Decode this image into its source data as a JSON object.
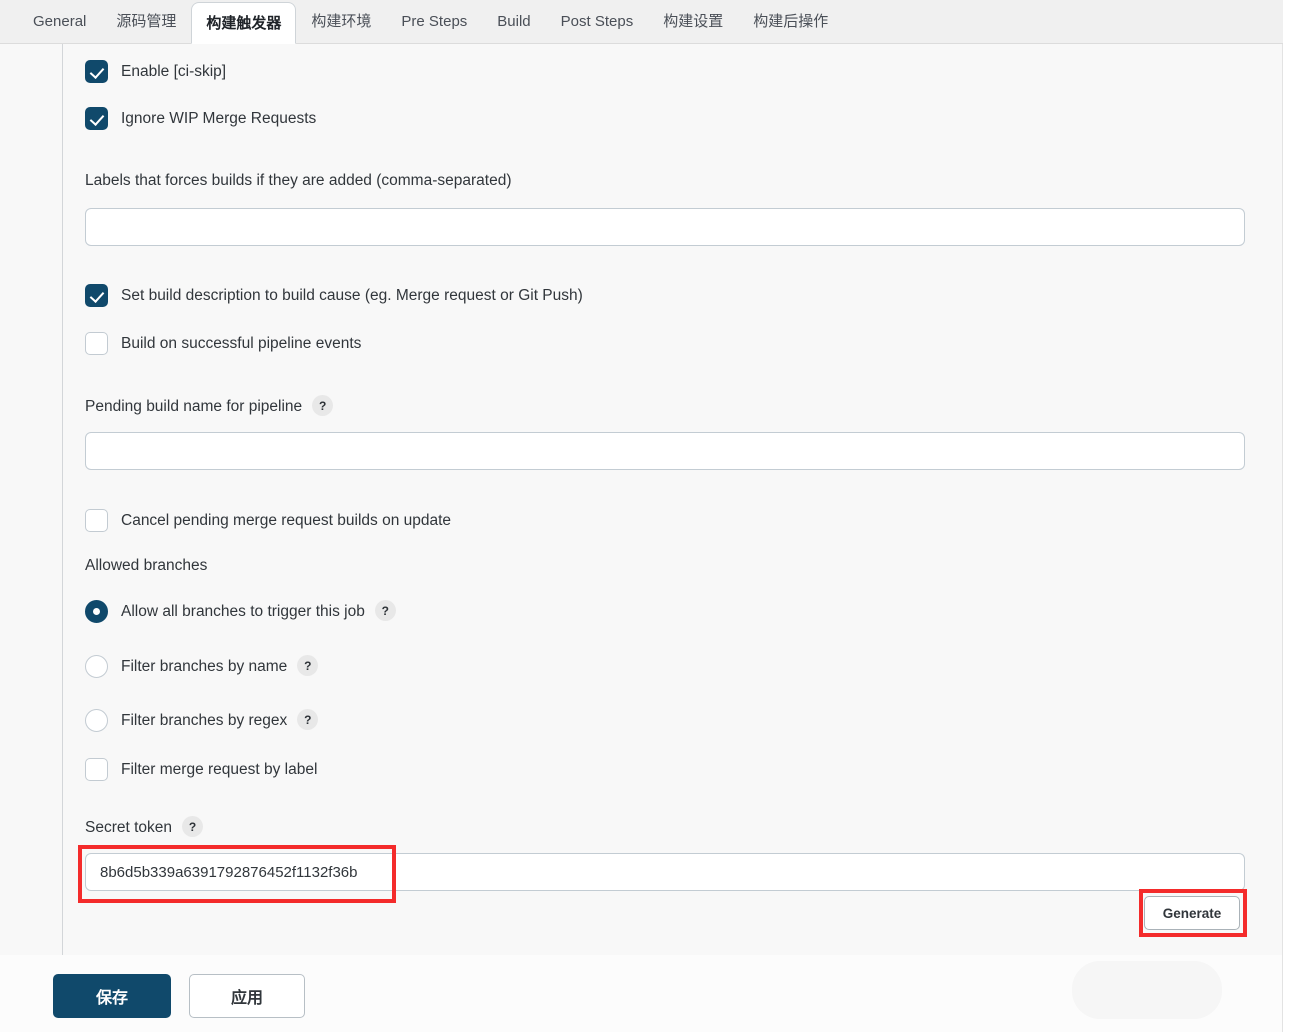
{
  "tabs": [
    {
      "label": "General",
      "active": false
    },
    {
      "label": "源码管理",
      "active": false
    },
    {
      "label": "构建触发器",
      "active": true
    },
    {
      "label": "构建环境",
      "active": false
    },
    {
      "label": "Pre Steps",
      "active": false
    },
    {
      "label": "Build",
      "active": false
    },
    {
      "label": "Post Steps",
      "active": false
    },
    {
      "label": "构建设置",
      "active": false
    },
    {
      "label": "构建后操作",
      "active": false
    }
  ],
  "form": {
    "enable_ci_skip": {
      "label": "Enable [ci-skip]",
      "checked": true
    },
    "ignore_wip": {
      "label": "Ignore WIP Merge Requests",
      "checked": true
    },
    "labels_field": {
      "label": "Labels that forces builds if they are added (comma-separated)",
      "value": "",
      "placeholder": ""
    },
    "set_build_description": {
      "label": "Set build description to build cause (eg. Merge request or Git Push)",
      "checked": true
    },
    "build_on_pipeline": {
      "label": "Build on successful pipeline events",
      "checked": false
    },
    "pending_build_name": {
      "label": "Pending build name for pipeline",
      "help": "?",
      "value": "",
      "placeholder": ""
    },
    "cancel_pending": {
      "label": "Cancel pending merge request builds on update",
      "checked": false
    },
    "allowed_branches_label": "Allowed branches",
    "branch_options": [
      {
        "label": "Allow all branches to trigger this job",
        "selected": true,
        "help": "?"
      },
      {
        "label": "Filter branches by name",
        "selected": false,
        "help": "?"
      },
      {
        "label": "Filter branches by regex",
        "selected": false,
        "help": "?"
      }
    ],
    "filter_by_label": {
      "label": "Filter merge request by label",
      "checked": false
    },
    "secret_token": {
      "label": "Secret token",
      "help": "?",
      "value": "8b6d5b339a6391792876452f1132f36b",
      "placeholder": ""
    },
    "generate_button": "Generate"
  },
  "footer": {
    "save_label": "保存",
    "apply_label": "应用"
  },
  "colors": {
    "accent": "#10496b",
    "annotation": "#f42b2b",
    "page_bg": "#f8f8f8",
    "tabbar_bg": "#f0f0f0",
    "input_border": "#c3ccd3"
  }
}
